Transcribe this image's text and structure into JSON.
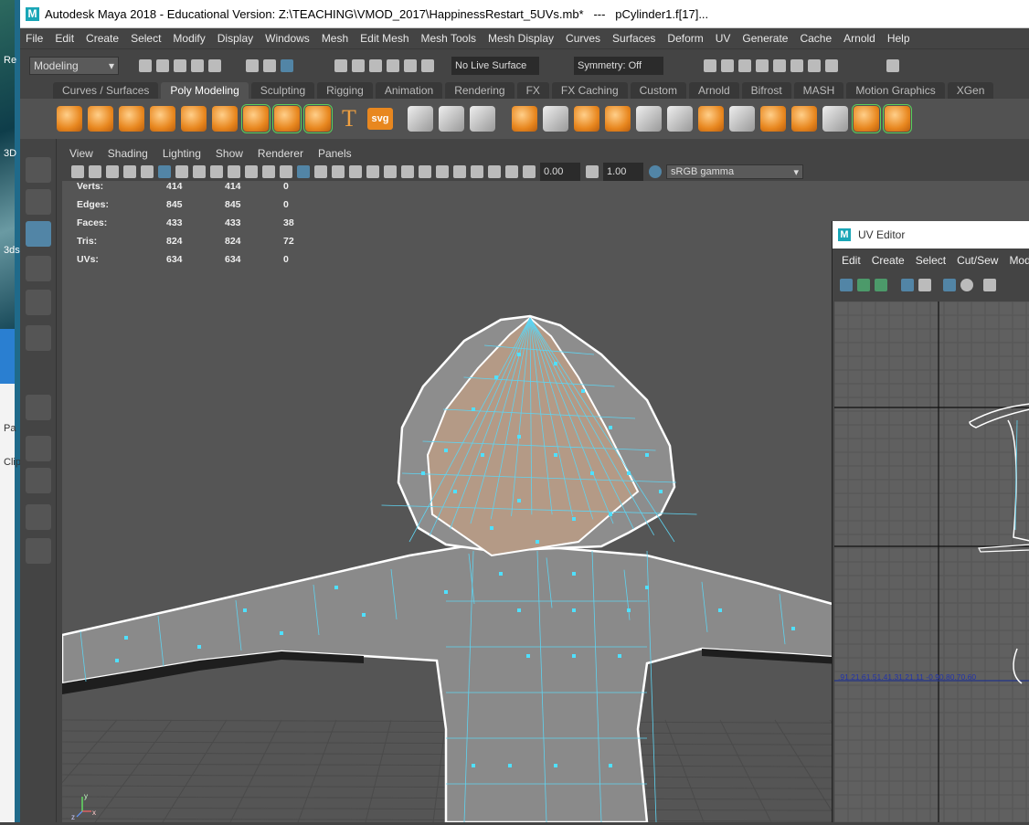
{
  "window": {
    "title": "Autodesk Maya 2018 - Educational Version: Z:\\TEACHING\\VMOD_2017\\HappinessRestart_5UVs.mb*   ---   pCylinder1.f[17]..."
  },
  "desktop": {
    "labels": [
      "Re",
      "3D",
      "3ds",
      "Pa",
      "Clip"
    ]
  },
  "menubar": {
    "items": [
      "File",
      "Edit",
      "Create",
      "Select",
      "Modify",
      "Display",
      "Windows",
      "Mesh",
      "Edit Mesh",
      "Mesh Tools",
      "Mesh Display",
      "Curves",
      "Surfaces",
      "Deform",
      "UV",
      "Generate",
      "Cache",
      "Arnold",
      "Help"
    ]
  },
  "statusline": {
    "menu_set": "Modeling",
    "live_surface": "No Live Surface",
    "symmetry": "Symmetry: Off"
  },
  "shelf": {
    "tabs": [
      "Curves / Surfaces",
      "Poly Modeling",
      "Sculpting",
      "Rigging",
      "Animation",
      "Rendering",
      "FX",
      "FX Caching",
      "Custom",
      "Arnold",
      "Bifrost",
      "MASH",
      "Motion Graphics",
      "XGen"
    ],
    "active_tab": "Poly Modeling",
    "text_icons": [
      "T",
      "svg"
    ]
  },
  "panel": {
    "menus": [
      "View",
      "Shading",
      "Lighting",
      "Show",
      "Renderer",
      "Panels"
    ],
    "exposure": "0.00",
    "gamma": "1.00",
    "color_space": "sRGB gamma"
  },
  "hud": {
    "rows": [
      {
        "label": "Verts:",
        "a": "414",
        "b": "414",
        "c": "0"
      },
      {
        "label": "Edges:",
        "a": "845",
        "b": "845",
        "c": "0"
      },
      {
        "label": "Faces:",
        "a": "433",
        "b": "433",
        "c": "38"
      },
      {
        "label": "Tris:",
        "a": "824",
        "b": "824",
        "c": "72"
      },
      {
        "label": "UVs:",
        "a": "634",
        "b": "634",
        "c": "0"
      }
    ]
  },
  "axis": {
    "labels": [
      "y",
      "x",
      "z"
    ]
  },
  "uv_editor": {
    "title": "UV Editor",
    "menus": [
      "Edit",
      "Create",
      "Select",
      "Cut/Sew",
      "Mod"
    ],
    "ruler": ".91.21.61.51.41.31.21.11  -0.90.80.70.60"
  },
  "colors": {
    "accent": "#5285a6",
    "mesh_wire": "#5fd3f0",
    "selected_face": "#b49a86",
    "shelf_orange": "#e8871f"
  }
}
